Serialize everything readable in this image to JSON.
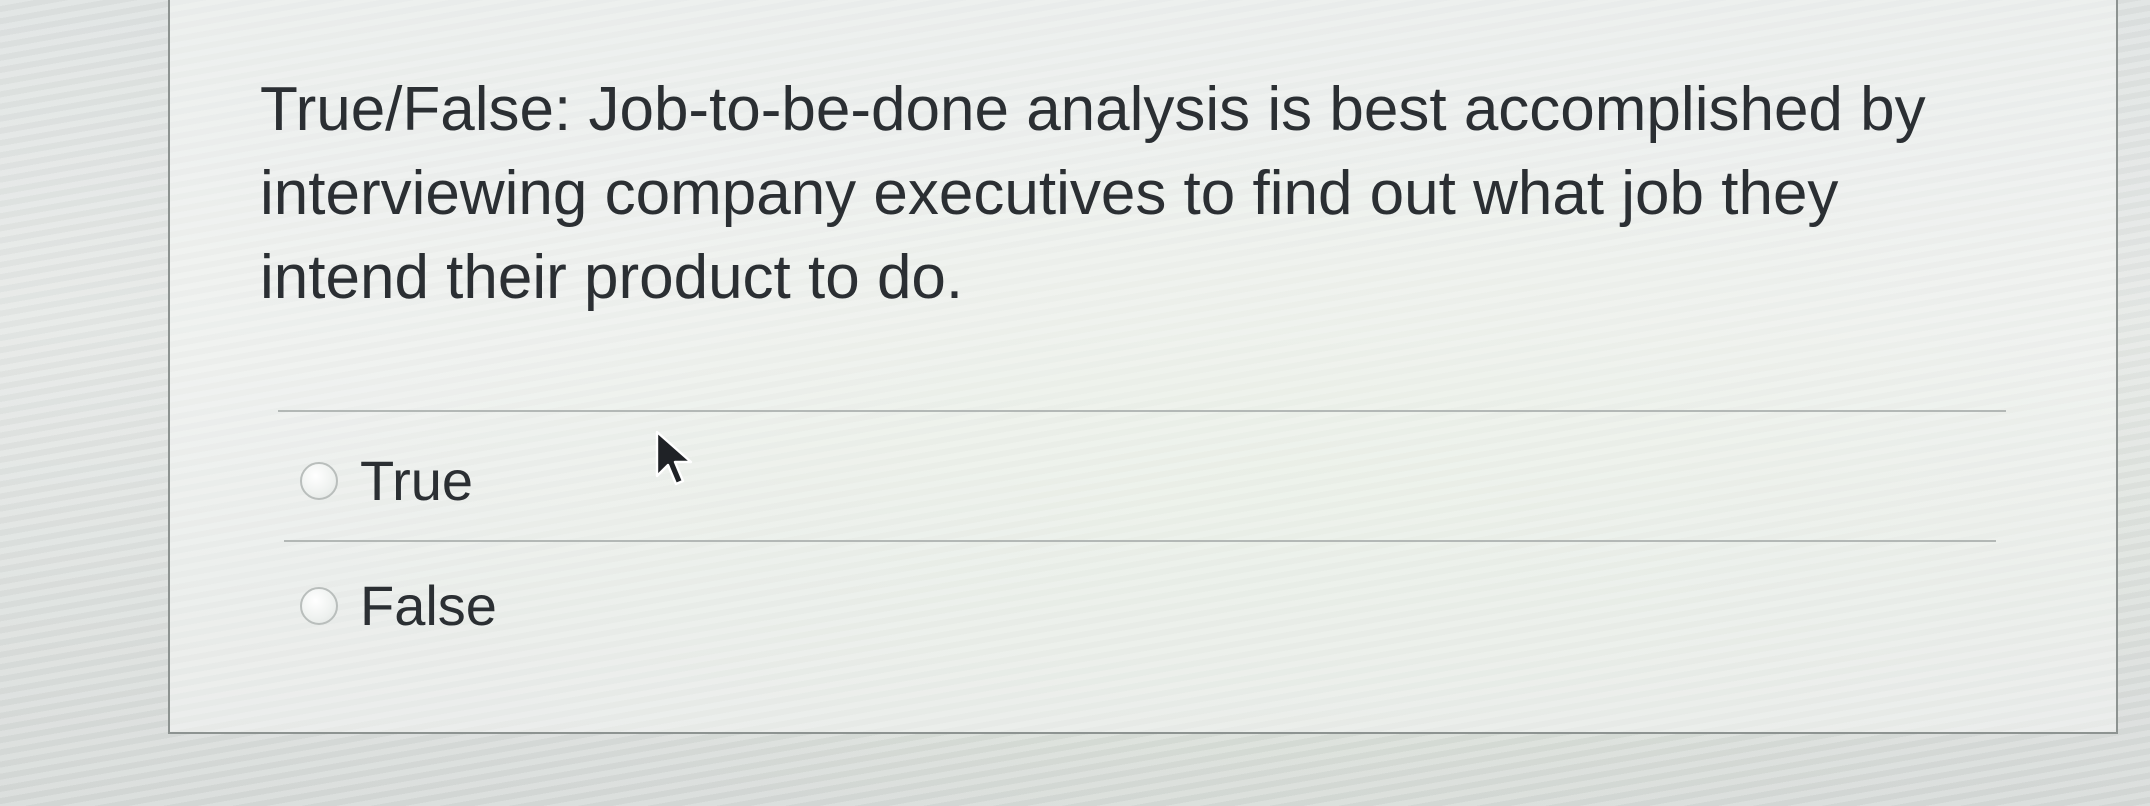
{
  "question": {
    "text": "True/False: Job-to-be-done analysis is best accomplished by interviewing company executives to find out what job they intend their product to do."
  },
  "options": [
    {
      "label": "True",
      "selected": false
    },
    {
      "label": "False",
      "selected": false
    }
  ],
  "icons": {
    "pointer": "mouse-pointer-icon",
    "radio": "radio-unchecked-icon"
  },
  "colors": {
    "text": "#2b2f33",
    "card_border": "#8d9391",
    "divider": "#b3b8b6"
  }
}
